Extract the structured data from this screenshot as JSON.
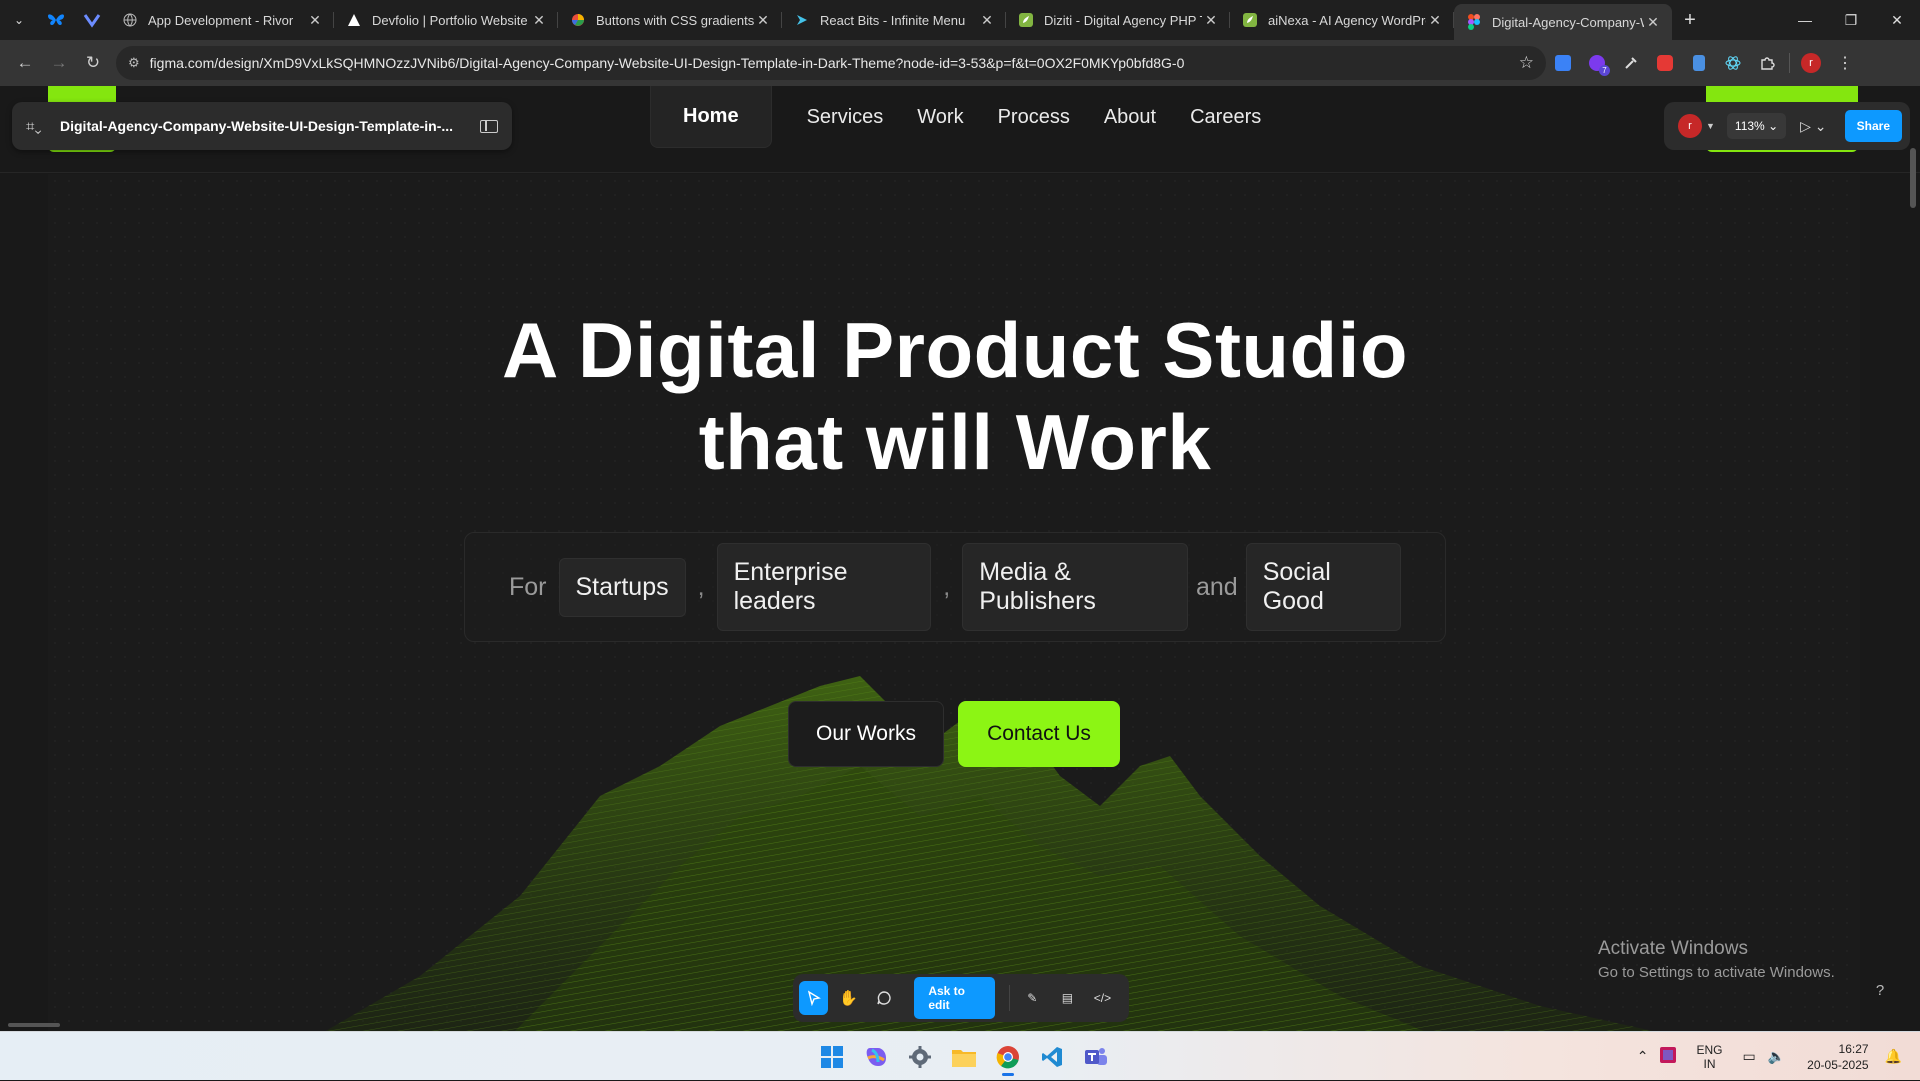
{
  "browser": {
    "tabs": [
      {
        "title": "App Development - Rivor",
        "close": "✕"
      },
      {
        "title": "Devfolio | Portfolio Website",
        "close": "✕"
      },
      {
        "title": "Buttons with CSS gradients",
        "close": "✕"
      },
      {
        "title": "React Bits - Infinite Menu",
        "close": "✕"
      },
      {
        "title": "Diziti - Digital Agency PHP Te",
        "close": "✕"
      },
      {
        "title": "aiNexa - AI Agency WordPre",
        "close": "✕"
      },
      {
        "title": "Digital-Agency-Company-W",
        "close": "✕"
      }
    ],
    "new_tab": "+",
    "url": "figma.com/design/XmD9VxLkSQHMNOzzJVNib6/Digital-Agency-Company-Website-UI-Design-Template-in-Dark-Theme?node-id=3-53&p=f&t=0OX2F0MKYp0bfd8G-0",
    "profile_initial": "r",
    "ext_badge": "7"
  },
  "figma": {
    "file_name": "Digital-Agency-Company-Website-UI-Design-Template-in-...",
    "avatar_initial": "r",
    "zoom": "113%",
    "share_label": "Share",
    "ask_label": "Ask to edit",
    "help": "?"
  },
  "site": {
    "nav": [
      "Home",
      "Services",
      "Work",
      "Process",
      "About",
      "Careers"
    ],
    "hero_line1": "A Digital Product Studio",
    "hero_line2": "that will Work",
    "for_word": "For",
    "tags": [
      "Startups",
      "Enterprise leaders",
      "Media & Publishers",
      "Social Good"
    ],
    "comma": ",",
    "and_word": "and",
    "btn_works": "Our Works",
    "btn_contact": "Contact Us",
    "accent": "#8cf514"
  },
  "windows": {
    "activate_title": "Activate Windows",
    "activate_sub": "Go to Settings to activate Windows.",
    "lang_top": "ENG",
    "lang_bottom": "IN",
    "time": "16:27",
    "date": "20-05-2025"
  }
}
